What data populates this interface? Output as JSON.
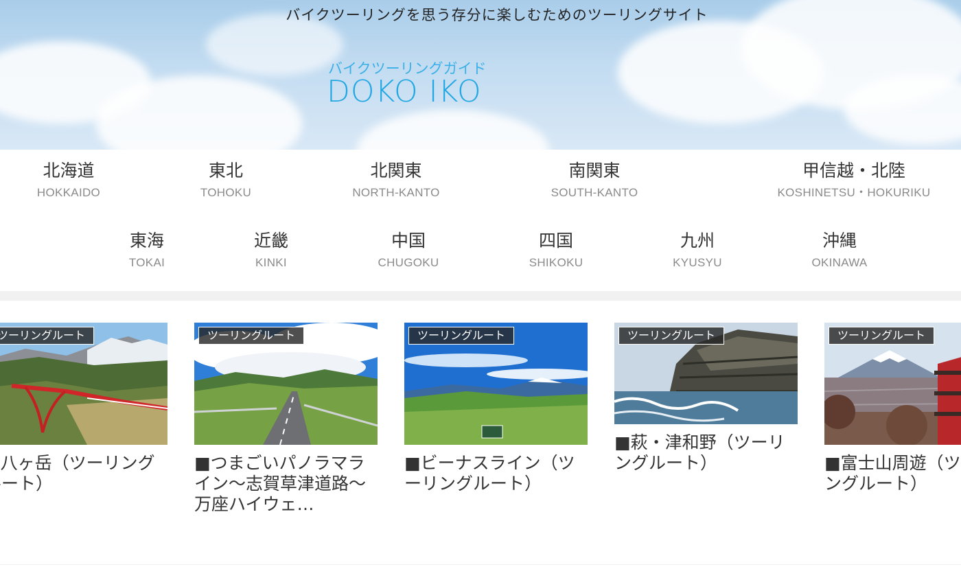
{
  "header": {
    "tagline": "バイクツーリングを思う存分に楽しむためのツーリングサイト",
    "logo_sub": "バイクツーリングガイド",
    "logo_main": "DOKO IKO"
  },
  "regions_row1": [
    {
      "jp": "北海道",
      "en": "HOKKAIDO"
    },
    {
      "jp": "東北",
      "en": "TOHOKU"
    },
    {
      "jp": "北関東",
      "en": "NORTH-KANTO"
    },
    {
      "jp": "南関東",
      "en": "SOUTH-KANTO"
    },
    {
      "jp": "甲信越・北陸",
      "en": "KOSHINETSU・HOKURIKU"
    }
  ],
  "regions_row2": [
    {
      "jp": "東海",
      "en": "TOKAI"
    },
    {
      "jp": "近畿",
      "en": "KINKI"
    },
    {
      "jp": "中国",
      "en": "CHUGOKU"
    },
    {
      "jp": "四国",
      "en": "SHIKOKU"
    },
    {
      "jp": "九州",
      "en": "KYUSYU"
    },
    {
      "jp": "沖縄",
      "en": "OKINAWA"
    }
  ],
  "cards": [
    {
      "badge": "ツーリングルート",
      "title": "■八ヶ岳（ツーリングルート）"
    },
    {
      "badge": "ツーリングルート",
      "title": "■つまごいパノラマライン～志賀草津道路～万座ハイウェ…"
    },
    {
      "badge": "ツーリングルート",
      "title": "■ビーナスライン（ツーリングルート）"
    },
    {
      "badge": "ツーリングルート",
      "title": "■萩・津和野（ツーリングルート）"
    },
    {
      "badge": "ツーリングルート",
      "title": "■富士山周遊（ツーリングルート）"
    }
  ],
  "colors": {
    "logo_blue": "#22a7e3",
    "badge_bg": "#282828",
    "nav_en_gray": "#8a8a8a"
  }
}
